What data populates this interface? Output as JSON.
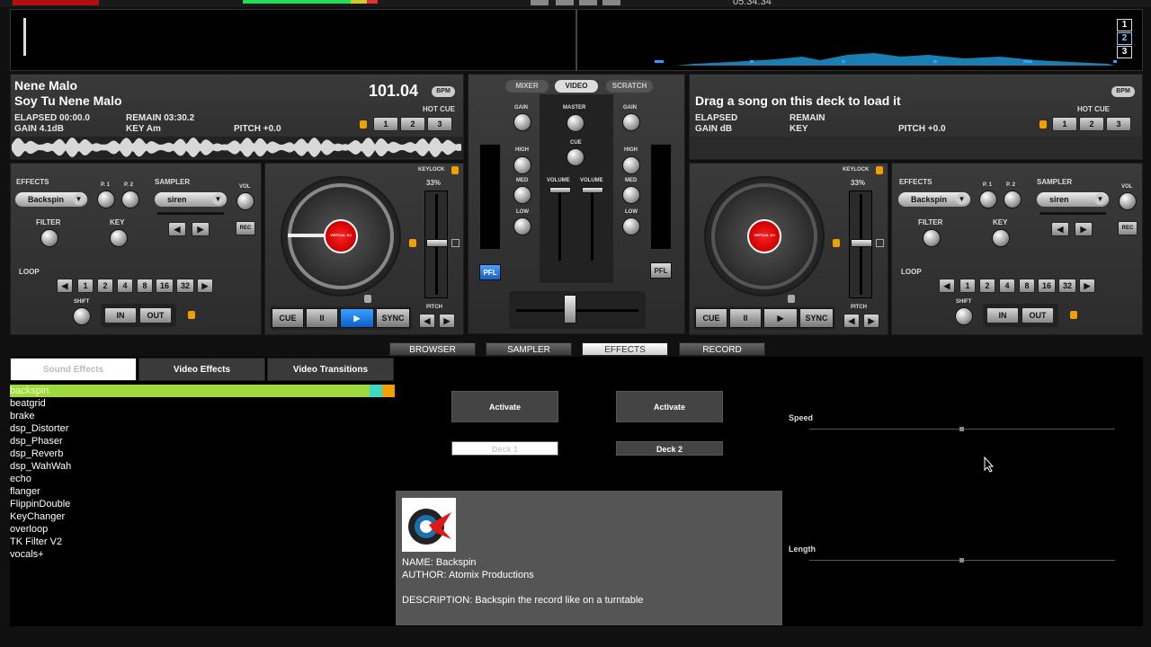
{
  "app": {
    "clock": "05:34:34"
  },
  "overview": {
    "deck_numbers": [
      "1",
      "2",
      "3"
    ]
  },
  "deckA": {
    "artist": "Nene Malo",
    "song": "Soy Tu Nene Malo",
    "bpm": "101.04",
    "bpm_tag": "BPM",
    "elapsed": "ELAPSED 00:00.0",
    "remain": "REMAIN 03:30.2",
    "gain": "GAIN 4.1dB",
    "key": "KEY Am",
    "pitch": "PITCH +0.0",
    "hotcue_label": "HOT CUE",
    "hotcues": [
      "1",
      "2",
      "3"
    ],
    "effects_label": "EFFECTS",
    "effect_selected": "Backspin",
    "p1": "P. 1",
    "p2": "P. 2",
    "sampler_label": "SAMPLER",
    "sampler_selected": "siren",
    "vol": "VOL",
    "rec": "REC",
    "filter": "FILTER",
    "keyknob": "KEY",
    "keylock": "KEYLOCK",
    "pitch_pct": "33%",
    "loop_label": "LOOP",
    "loops": [
      "1",
      "2",
      "4",
      "8",
      "16",
      "32"
    ],
    "shift": "SHIFT",
    "in": "IN",
    "out": "OUT",
    "pitch_lbl": "PITCH",
    "cue": "CUE",
    "pause": "II",
    "play": "▶",
    "sync": "SYNC",
    "platter_label": "VIRTUAL DJ"
  },
  "deckB": {
    "title": "Drag a song on this deck to load it",
    "bpm_tag": "BPM",
    "elapsed": "ELAPSED",
    "remain": "REMAIN",
    "gain": "GAIN dB",
    "key": "KEY",
    "pitch": "PITCH +0.0",
    "hotcue_label": "HOT CUE",
    "hotcues": [
      "1",
      "2",
      "3"
    ],
    "effects_label": "EFFECTS",
    "effect_selected": "Backspin",
    "p1": "P. 1",
    "p2": "P. 2",
    "sampler_label": "SAMPLER",
    "sampler_selected": "siren",
    "vol": "VOL",
    "rec": "REC",
    "filter": "FILTER",
    "keyknob": "KEY",
    "keylock": "KEYLOCK",
    "pitch_pct": "33%",
    "loop_label": "LOOP",
    "loops": [
      "1",
      "2",
      "4",
      "8",
      "16",
      "32"
    ],
    "shift": "SHIFT",
    "in": "IN",
    "out": "OUT",
    "pitch_lbl": "PITCH",
    "cue": "CUE",
    "pause": "II",
    "play": "▶",
    "sync": "SYNC",
    "platter_label": "VIRTUAL DJ"
  },
  "mixer": {
    "tabs": [
      "MIXER",
      "VIDEO",
      "SCRATCH"
    ],
    "gain": "GAIN",
    "master": "MASTER",
    "cue": "CUE",
    "high": "HIGH",
    "med": "MED",
    "low": "LOW",
    "volume": "VOLUME",
    "pfl": "PFL"
  },
  "bottom_tabs": [
    "BROWSER",
    "SAMPLER",
    "EFFECTS",
    "RECORD"
  ],
  "effects_panel": {
    "subtabs": [
      "Sound Effects",
      "Video Effects",
      "Video Transitions"
    ],
    "list": [
      "backspin",
      "beatgrid",
      "brake",
      "dsp_Distorter",
      "dsp_Phaser",
      "dsp_Reverb",
      "dsp_WahWah",
      "echo",
      "flanger",
      "FlippinDouble",
      "KeyChanger",
      "overloop",
      "TK Filter V2",
      "vocals+"
    ],
    "activate1": "Activate",
    "activate2": "Activate",
    "deck1": "Deck 1",
    "deck2": "Deck 2",
    "speed": "Speed",
    "length": "Length",
    "name": "NAME: Backspin",
    "author": "AUTHOR: Atomix Productions",
    "description": "DESCRIPTION: Backspin the record like on a turntable"
  }
}
